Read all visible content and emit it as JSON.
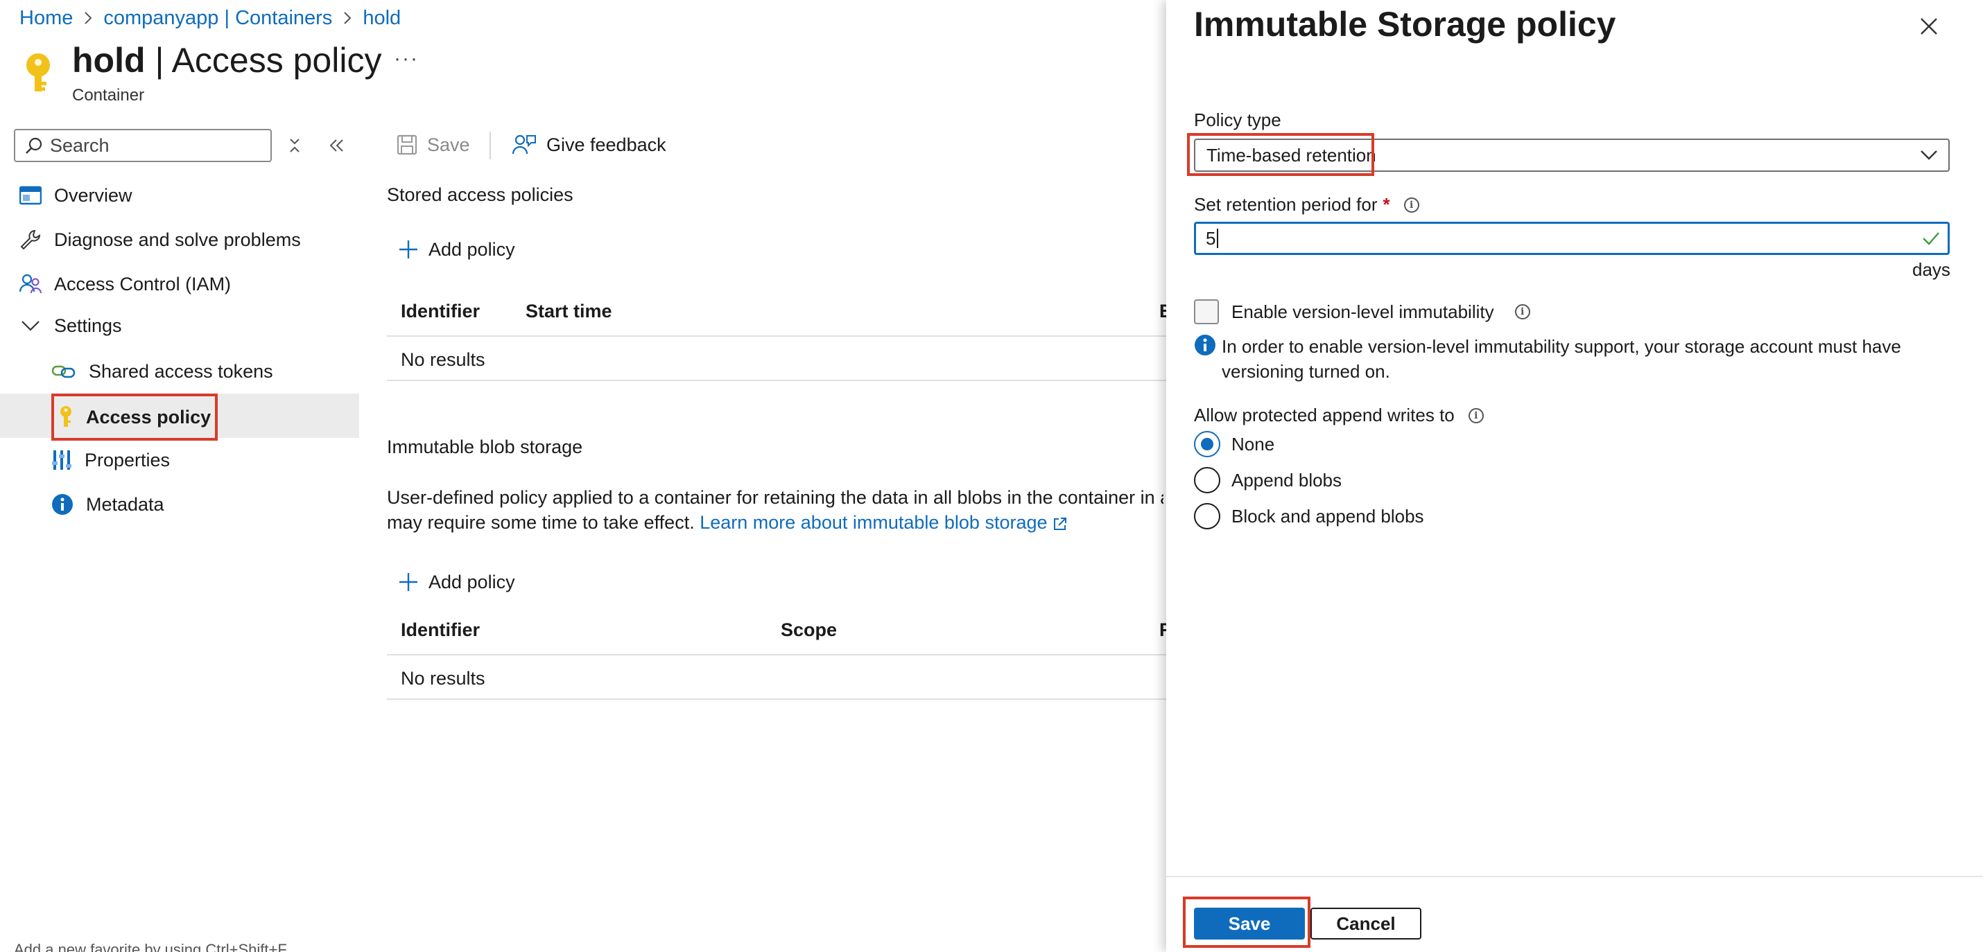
{
  "breadcrumb": [
    "Home",
    "companyapp | Containers",
    "hold"
  ],
  "header": {
    "name": "hold",
    "separator": "|",
    "page": "Access policy",
    "subtitle": "Container",
    "more": "···"
  },
  "sidebar": {
    "search_placeholder": "Search",
    "items": [
      {
        "label": "Overview"
      },
      {
        "label": "Diagnose and solve problems"
      },
      {
        "label": "Access Control (IAM)"
      },
      {
        "label": "Settings"
      },
      {
        "label": "Shared access tokens"
      },
      {
        "label": "Access policy",
        "selected": true
      },
      {
        "label": "Properties"
      },
      {
        "label": "Metadata"
      }
    ]
  },
  "toolbar": {
    "save_label": "Save",
    "feedback_label": "Give feedback"
  },
  "stored_policies": {
    "title": "Stored access policies",
    "add_label": "Add policy",
    "columns": [
      "Identifier",
      "Start time",
      "E"
    ],
    "empty": "No results"
  },
  "immutable": {
    "title": "Immutable blob storage",
    "desc_line1": "User-defined policy applied to a container for retaining the data in all blobs in the container in a no",
    "desc_line2": "may require some time to take effect.",
    "learn_more": "Learn more about immutable blob storage",
    "add_label": "Add policy",
    "columns": [
      "Identifier",
      "Scope",
      "F"
    ],
    "empty": "No results"
  },
  "panel": {
    "title": "Immutable Storage policy",
    "policy_type_label": "Policy type",
    "policy_type_value": "Time-based retention",
    "retention_label": "Set retention period for",
    "required_mark": "*",
    "retention_value": "5",
    "retention_unit": "days",
    "version_label": "Enable version-level immutability",
    "version_checked": false,
    "info_line1": "In order to enable version-level immutability support, your storage account must have",
    "info_line2": "versioning turned on.",
    "append_label": "Allow protected append writes to",
    "append_options": [
      "None",
      "Append blobs",
      "Block and append blobs"
    ],
    "append_selected": "None",
    "save_label": "Save",
    "cancel_label": "Cancel"
  },
  "footer_hint": "Add a new favorite by using Ctrl+Shift+F",
  "colors": {
    "accent": "#0f6cbd",
    "highlight": "#d83b2a",
    "selected_bg": "#ebebeb",
    "key_icon": "#f2c21b"
  }
}
